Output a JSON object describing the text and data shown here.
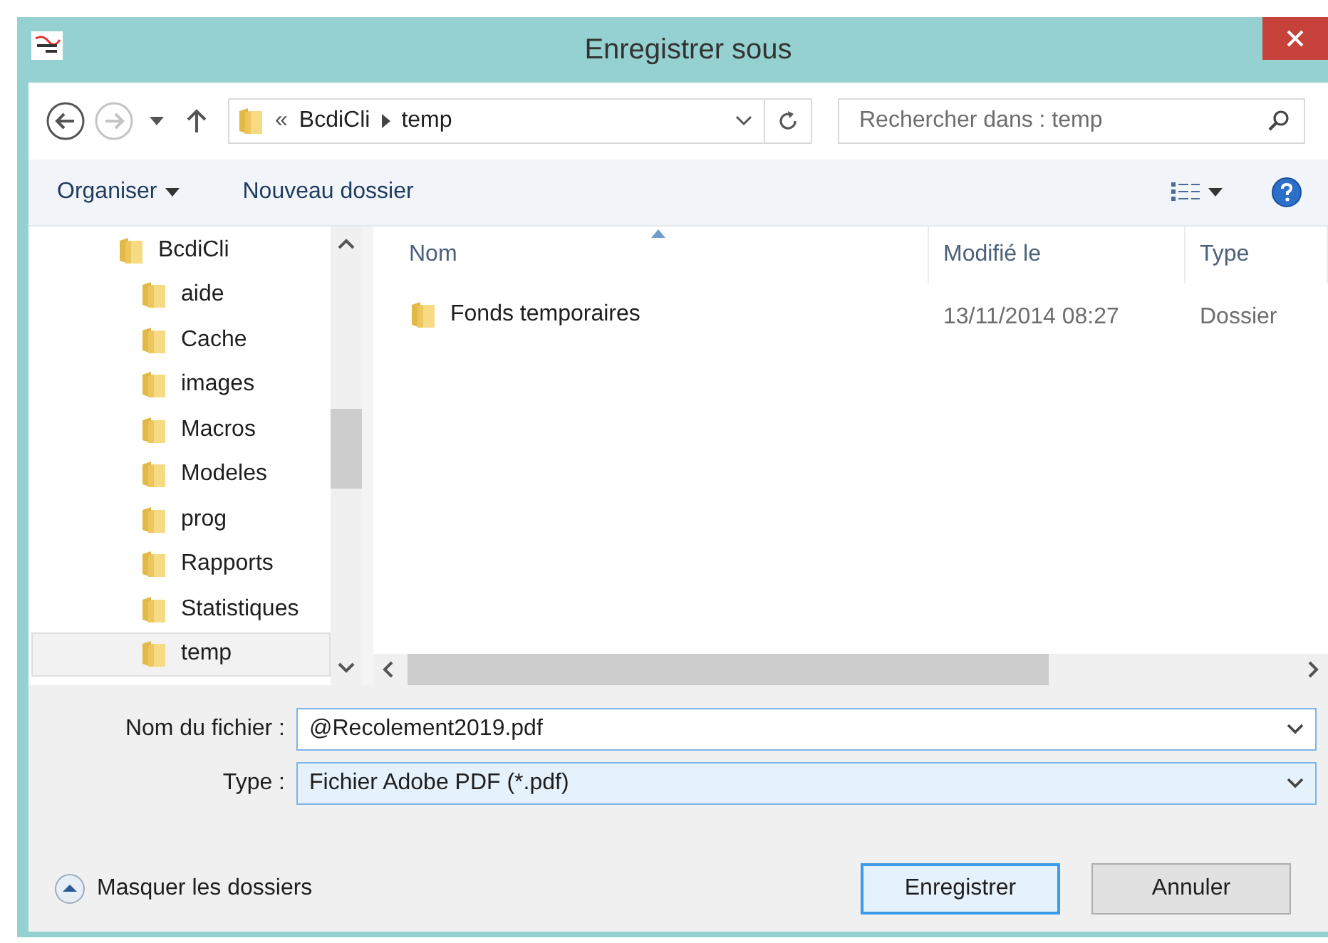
{
  "window": {
    "title": "Enregistrer sous"
  },
  "nav": [
    {
      "kind": "back",
      "disabled": false
    },
    {
      "kind": "forward",
      "disabled": true
    },
    {
      "kind": "recent",
      "disabled": false
    },
    {
      "kind": "up",
      "disabled": false
    }
  ],
  "address": {
    "overflow": "«",
    "path": [
      "BcdiCli",
      "temp"
    ]
  },
  "search": {
    "placeholder": "Rechercher dans : temp"
  },
  "toolbar": [
    {
      "label": "Organiser",
      "kind": "menu"
    },
    {
      "label": "Nouveau dossier",
      "kind": "button"
    }
  ],
  "tree": [
    {
      "label": "BcdiCli",
      "selected": false,
      "children": [
        {
          "label": "aide",
          "selected": false
        },
        {
          "label": "Cache",
          "selected": false
        },
        {
          "label": "images",
          "selected": false
        },
        {
          "label": "Macros",
          "selected": false
        },
        {
          "label": "Modeles",
          "selected": false
        },
        {
          "label": "prog",
          "selected": false
        },
        {
          "label": "Rapports",
          "selected": false
        },
        {
          "label": "Statistiques",
          "selected": false
        },
        {
          "label": "temp",
          "selected": true
        }
      ]
    }
  ],
  "table": {
    "columns": [
      {
        "label": "Nom",
        "sorted": true
      },
      {
        "label": "Modifié le",
        "sorted": false
      },
      {
        "label": "Type",
        "sorted": false
      }
    ],
    "rows": [
      {
        "cells": [
          "Fonds temporaires",
          "13/11/2014 08:27",
          "Dossier"
        ]
      }
    ]
  },
  "form": [
    {
      "label": "Nom du fichier :",
      "value": "@Recolement2019.pdf",
      "kind": "combo"
    },
    {
      "label": "Type :",
      "value": "Fichier Adobe PDF (*.pdf)",
      "kind": "select"
    }
  ],
  "hide_folders": "Masquer les dossiers",
  "buttons": [
    {
      "label": "Enregistrer",
      "default": true
    },
    {
      "label": "Annuler",
      "default": false
    }
  ]
}
